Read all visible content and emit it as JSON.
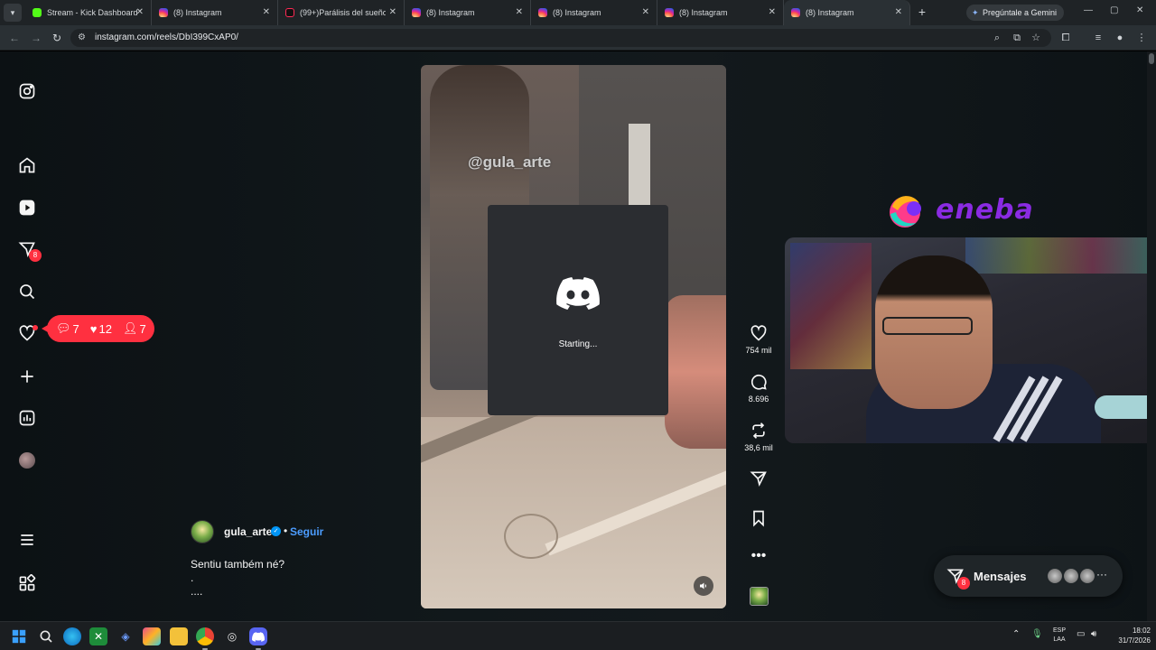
{
  "browser": {
    "tabs": [
      {
        "label": "Stream - Kick Dashboard",
        "favicon": "kick"
      },
      {
        "label": "(8) Instagram",
        "favicon": "instagram"
      },
      {
        "label": "(99+)Parálisis del sueño e",
        "favicon": "tiktok"
      },
      {
        "label": "(8) Instagram",
        "favicon": "instagram"
      },
      {
        "label": "(8) Instagram",
        "favicon": "instagram"
      },
      {
        "label": "(8) Instagram",
        "favicon": "instagram"
      },
      {
        "label": "(8) Instagram",
        "favicon": "instagram",
        "active": true
      }
    ],
    "gemini_label": "Pregúntale a Gemini",
    "url": "instagram.com/reels/DbI399CxAP0/"
  },
  "nav": {
    "notifications_badge": "8",
    "activity": {
      "comments": "7",
      "likes": "12",
      "follows": "7"
    }
  },
  "reel": {
    "watermark": "@gula_arte",
    "author": "gula_arte",
    "follow_label": "Seguir",
    "separator": "•",
    "caption_lines": [
      "Sentiu também né?",
      ".",
      "...."
    ],
    "likes": "754 mil",
    "comments": "8.696",
    "reposts": "38,6 mil"
  },
  "discord": {
    "status": "Starting..."
  },
  "overlay": {
    "sponsor": "eneba"
  },
  "messages": {
    "label": "Mensajes",
    "badge": "8"
  },
  "taskbar": {
    "language": "ESP",
    "layout": "LAA",
    "time": "18:02",
    "date": "31/7/2026"
  },
  "colors": {
    "accent_red": "#ff3040",
    "link_blue": "#4c9dff",
    "discord_bg": "#2b2d31",
    "eneba_purple": "#8a2be2"
  }
}
